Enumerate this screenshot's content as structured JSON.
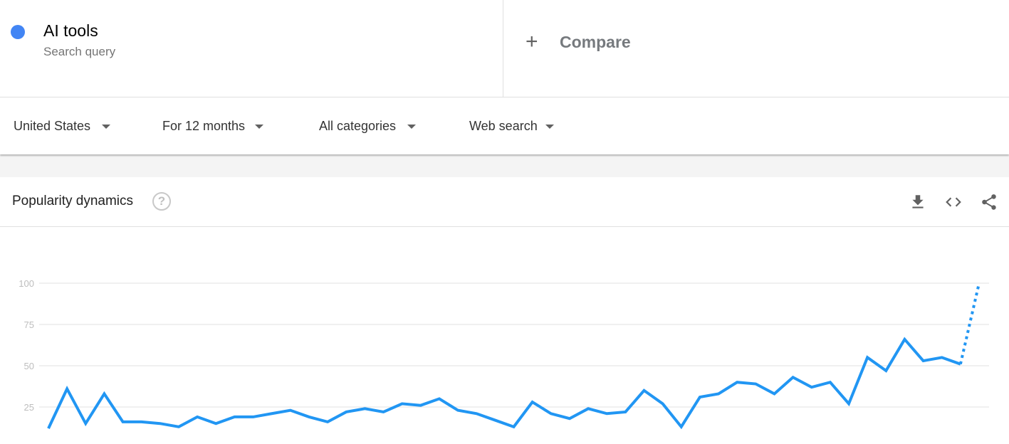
{
  "term": {
    "name": "AI tools",
    "type": "Search query",
    "color": "#4285f4"
  },
  "compare": {
    "label": "Compare",
    "icon": "plus-icon"
  },
  "filters": [
    {
      "label": "United States"
    },
    {
      "label": "For 12 months"
    },
    {
      "label": "All categories"
    },
    {
      "label": "Web search"
    }
  ],
  "card": {
    "title": "Popularity dynamics",
    "help_icon": "?",
    "actions": [
      "download-icon",
      "embed-icon",
      "share-icon"
    ]
  },
  "chart_data": {
    "type": "line",
    "title": "Popularity dynamics",
    "xlabel": "",
    "ylabel": "",
    "ylim": [
      0,
      100
    ],
    "yticks": [
      25,
      50,
      75,
      100
    ],
    "grid": true,
    "series": [
      {
        "name": "AI tools",
        "color": "#2196f3",
        "values": [
          12,
          36,
          15,
          33,
          16,
          16,
          15,
          13,
          19,
          15,
          19,
          19,
          21,
          23,
          19,
          16,
          22,
          24,
          22,
          27,
          26,
          30,
          23,
          21,
          17,
          13,
          28,
          21,
          18,
          24,
          21,
          22,
          35,
          27,
          13,
          31,
          33,
          40,
          39,
          33,
          43,
          37,
          40,
          27,
          55,
          47,
          66,
          53,
          55,
          51,
          100
        ],
        "partial_last_point": true
      }
    ]
  }
}
